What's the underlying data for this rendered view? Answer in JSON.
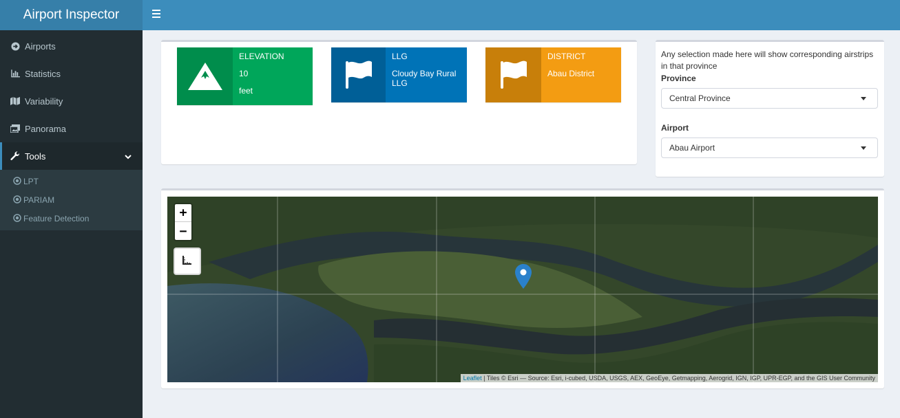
{
  "app": {
    "title": "Airport Inspector"
  },
  "sidebar": {
    "items": [
      {
        "label": "Airports",
        "icon": "arrow-circle-right-icon"
      },
      {
        "label": "Statistics",
        "icon": "bar-chart-icon"
      },
      {
        "label": "Variability",
        "icon": "map-icon"
      },
      {
        "label": "Panorama",
        "icon": "images-icon"
      },
      {
        "label": "Tools",
        "icon": "wrench-icon"
      }
    ],
    "subitems": [
      {
        "label": "LPT",
        "icon": "circle-icon"
      },
      {
        "label": "PARIAM",
        "icon": "circle-icon"
      },
      {
        "label": "Feature Detection",
        "icon": "circle-icon"
      }
    ]
  },
  "infoboxes": {
    "elevation": {
      "title": "ELEVATION",
      "value": "10",
      "unit": "feet",
      "icon": "mountain-icon",
      "color": "#00a65a",
      "icon_bg": "#008d4c"
    },
    "llg": {
      "title": "LLG",
      "value": "Cloudy Bay Rural LLG",
      "icon": "flag-icon",
      "color": "#0073b7",
      "icon_bg": "#005f97"
    },
    "district": {
      "title": "DISTRICT",
      "value": "Abau District",
      "icon": "flag-icon",
      "color": "#f39c12",
      "icon_bg": "#c87f0a"
    }
  },
  "filters": {
    "help_text": "Any selection made here will show corresponding airstrips in that province",
    "province_label": "Province",
    "province_value": "Central Province",
    "airport_label": "Airport",
    "airport_value": "Abau Airport"
  },
  "map": {
    "zoom_in": "+",
    "zoom_out": "−",
    "attribution_link": "Leaflet",
    "attribution_text": " | Tiles © Esri — Source: Esri, i-cubed, USDA, USGS, AEX, GeoEye, Getmapping, Aerogrid, IGN, IGP, UPR-EGP, and the GIS User Community"
  }
}
